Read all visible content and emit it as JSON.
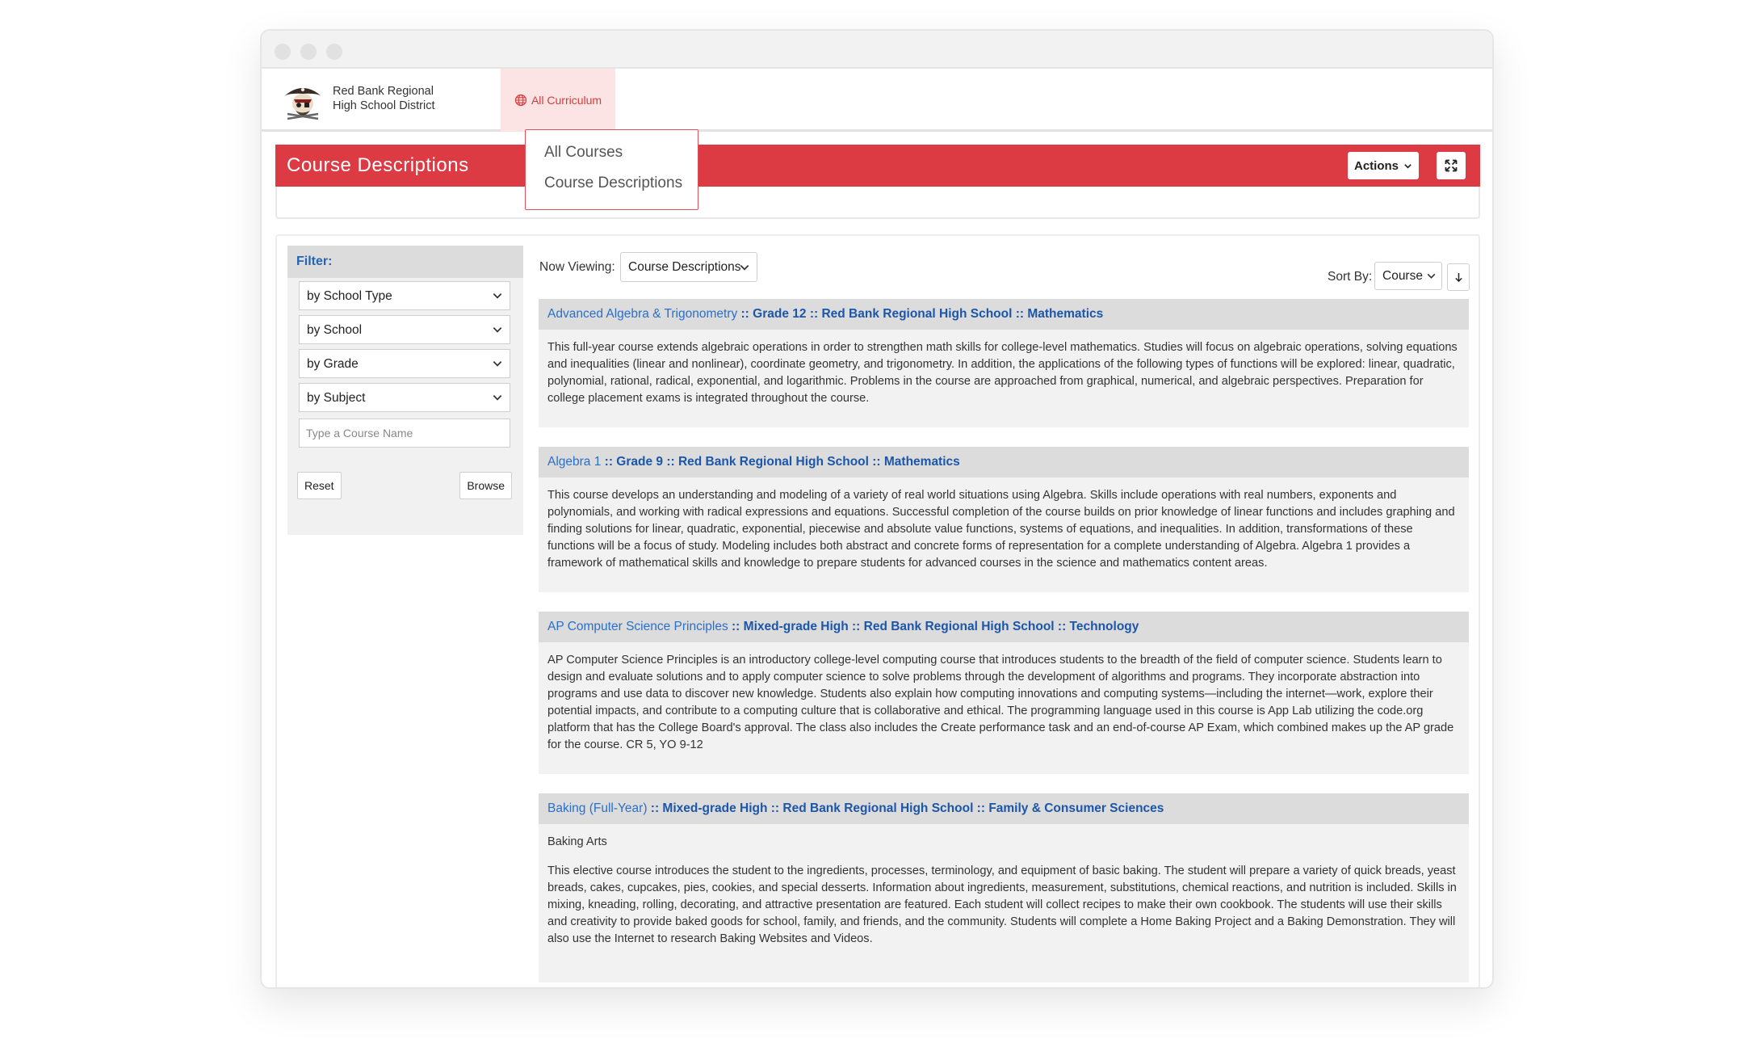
{
  "window": {
    "control_dots": [
      "close",
      "minimize",
      "maximize"
    ]
  },
  "district": {
    "name_line1": "Red Bank Regional",
    "name_line2": "High School District",
    "logo_icon": "pirate-mascot-icon"
  },
  "topnav": {
    "all_curriculum_label": "All Curriculum",
    "globe_icon": "globe-icon"
  },
  "dropdown_menu": {
    "items": [
      "All Courses",
      "Course Descriptions"
    ]
  },
  "page_header": {
    "title": "Course Descriptions",
    "actions_label": "Actions",
    "fullscreen_icon": "expand-icon",
    "accent_color": "#dc3b44"
  },
  "filter": {
    "title": "Filter:",
    "selects": [
      "by School Type",
      "by School",
      "by Grade",
      "by Subject"
    ],
    "course_placeholder": "Type a Course Name",
    "reset_label": "Reset",
    "browse_label": "Browse"
  },
  "viewing": {
    "label": "Now Viewing:",
    "value": "Course Descriptions"
  },
  "sort": {
    "label": "Sort By:",
    "value": "Course",
    "direction_icon": "arrow-down-icon"
  },
  "courses": [
    {
      "name": "Advanced Algebra & Trigonometry",
      "grade": "Grade 12",
      "school": "Red Bank Regional High School",
      "subject": "Mathematics",
      "subtitle": "",
      "description": "This full-year course extends algebraic operations in order to strengthen math skills for college-level mathematics. Studies will focus on algebraic operations, solving equations and inequalities (linear and nonlinear), coordinate geometry, and trigonometry. In addition, the applications of the following types of functions will be explored: linear, quadratic, polynomial, rational, radical, exponential, and logarithmic. Problems in the course are approached from graphical, numerical, and algebraic perspectives. Preparation for college placement exams is integrated throughout the course."
    },
    {
      "name": "Algebra 1",
      "grade": "Grade 9",
      "school": "Red Bank Regional High School",
      "subject": "Mathematics",
      "subtitle": "",
      "description": "This course develops an understanding and modeling of a variety of real world situations using Algebra. Skills include operations with real numbers, exponents and polynomials, and working with radical expressions and equations. Successful completion of the course builds on prior knowledge of linear functions and includes graphing and finding solutions for linear, quadratic, exponential, piecewise and absolute value functions, systems of equations, and inequalities. In addition, transformations of these functions will be a focus of study. Modeling includes both abstract and concrete forms of representation for a complete understanding of Algebra. Algebra 1 provides a framework of mathematical skills and knowledge to prepare students for advanced courses in the science and mathematics content areas."
    },
    {
      "name": "AP Computer Science Principles",
      "grade": "Mixed-grade High",
      "school": "Red Bank Regional High School",
      "subject": "Technology",
      "subtitle": "",
      "description": "AP Computer Science Principles is an introductory college-level computing course that introduces students to the breadth of the field of computer science. Students learn to design and evaluate solutions and to apply computer science to solve problems through the development of algorithms and programs. They incorporate abstraction into programs and use data to discover new knowledge. Students also explain how computing innovations and computing systems—including the internet—work, explore their potential impacts, and contribute to a computing culture that is collaborative and ethical. The programming language used in this course is App Lab utilizing the code.org platform that has the College Board's approval. The class also includes the Create performance task and an end-of-course AP Exam, which combined makes up the AP grade for the course. CR 5, YO 9-12"
    },
    {
      "name": "Baking (Full-Year)",
      "grade": "Mixed-grade High",
      "school": "Red Bank Regional High School",
      "subject": "Family & Consumer Sciences",
      "subtitle": "Baking Arts",
      "description": "This elective course introduces the student to the ingredients, processes, terminology, and equipment of basic baking. The student will prepare a variety of quick breads, yeast breads, cakes, cupcakes, pies, cookies, and special desserts. Information about ingredients, measurement, substitutions, chemical reactions, and nutrition is included. Skills in mixing, kneading, rolling, decorating, and attractive presentation are featured. Each student will collect recipes to make their own cookbook. The students will use their skills and creativity to provide baked goods for school, family, and friends, and the community. Students will complete a Home Baking Project and a Baking Demonstration. They will also use the Internet to research Baking Websites and Videos."
    }
  ]
}
